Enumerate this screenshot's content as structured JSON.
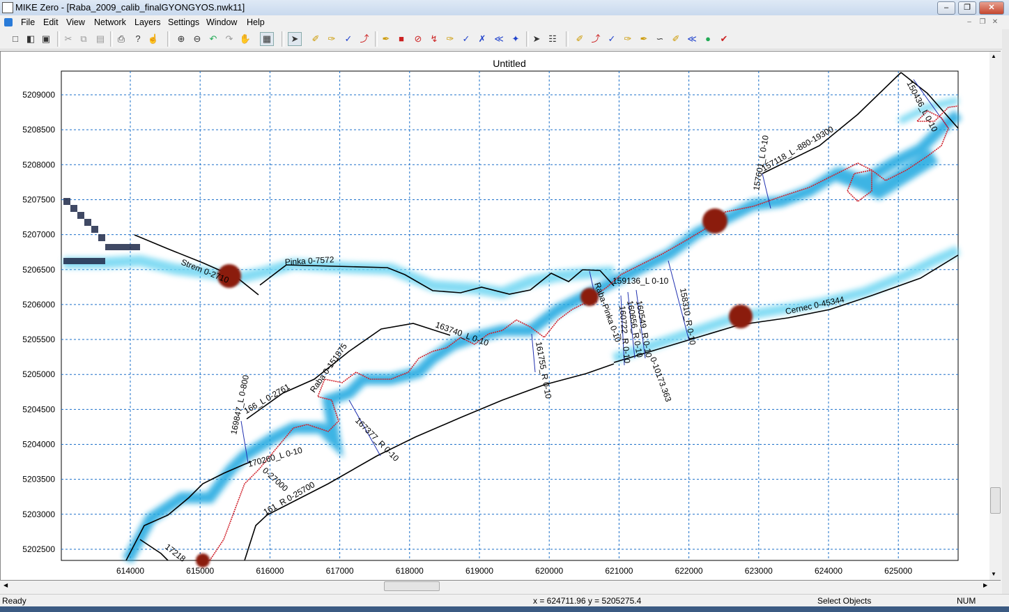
{
  "window": {
    "title": "MIKE Zero - [Raba_2009_calib_finalGYONGYOS.nwk11]",
    "minimize": "–",
    "restore": "❐",
    "close": "✕"
  },
  "menu": {
    "items": [
      "File",
      "Edit",
      "View",
      "Network",
      "Layers",
      "Settings",
      "Window",
      "Help"
    ],
    "mdi_min": "–",
    "mdi_restore": "❐",
    "mdi_close": "✕"
  },
  "toolbar": {
    "icons": [
      "new-icon",
      "open-icon",
      "save-icon",
      "cut-icon",
      "copy-icon",
      "paste-icon",
      "print-icon",
      "help-icon",
      "context-help-icon",
      "zoom-in-icon",
      "zoom-out-icon",
      "zoom-previous-icon",
      "zoom-next-icon",
      "pan-icon",
      "zoom-extent-icon",
      "select-icon",
      "add-point-icon",
      "add-branch-icon",
      "edit-points-icon",
      "connect-icon",
      "insert-structure-icon",
      "weir-icon",
      "culvert-icon",
      "bridge-icon",
      "pump-icon",
      "regulating-icon",
      "control-icon",
      "dambreak-icon",
      "user-structure-icon",
      "select-branch-icon",
      "find-icon",
      "cross-section-icon",
      "chainage-icon",
      "boundary-icon",
      "rr-link-icon",
      "catchment-icon",
      "runoff-icon",
      "link-icon",
      "lateral-icon",
      "node-icon",
      "gate-icon"
    ]
  },
  "map": {
    "title": "Untitled",
    "x_ticks": [
      "614000",
      "615000",
      "616000",
      "617000",
      "618000",
      "619000",
      "620000",
      "621000",
      "622000",
      "623000",
      "624000",
      "625000"
    ],
    "y_ticks": [
      "5209000",
      "5208500",
      "5208000",
      "5207500",
      "5207000",
      "5206500",
      "5206000",
      "5205500",
      "5205000",
      "5204500",
      "5204000",
      "5203500",
      "5203000",
      "5202500"
    ],
    "colors": {
      "branch": "#000000",
      "river": "#d0202a",
      "flood": "#1aa7e0",
      "grid": "#1a6fc9",
      "xsection": "#2030b0",
      "node": "#8b1a10"
    },
    "labels": [
      {
        "text": "Pinka  0-7572"
      },
      {
        "text": "Strem  0-2710"
      },
      {
        "text": "159136_L  0-10"
      },
      {
        "text": "Cernec  0-45344"
      },
      {
        "text": "150436_L  0-10"
      },
      {
        "text": "157601_L  0-10"
      },
      {
        "text": "157118_L  -880-19300"
      },
      {
        "text": "158310_R  0-10"
      },
      {
        "text": "Raba-Pinka  0-10"
      },
      {
        "text": "160549_R  0-10"
      },
      {
        "text": "160722_R  0-10"
      },
      {
        "text": "160656_R  0-10"
      },
      {
        "text": "0-10173.363"
      },
      {
        "text": "163740_L  0-10"
      },
      {
        "text": "161755_R  0-10"
      },
      {
        "text": "Raba  0-151875"
      },
      {
        "text": "166_L  0-2761"
      },
      {
        "text": "169847_L  0-800"
      },
      {
        "text": "167377_R  0-10"
      },
      {
        "text": "170260_L  0-10"
      },
      {
        "text": "0-27000"
      },
      {
        "text": "161_R  0-25700"
      },
      {
        "text": "17218"
      }
    ]
  },
  "status": {
    "ready": "Ready",
    "coords": "x = 624711.96  y = 5205275.4",
    "mode": "Select Objects",
    "num": "NUM"
  }
}
